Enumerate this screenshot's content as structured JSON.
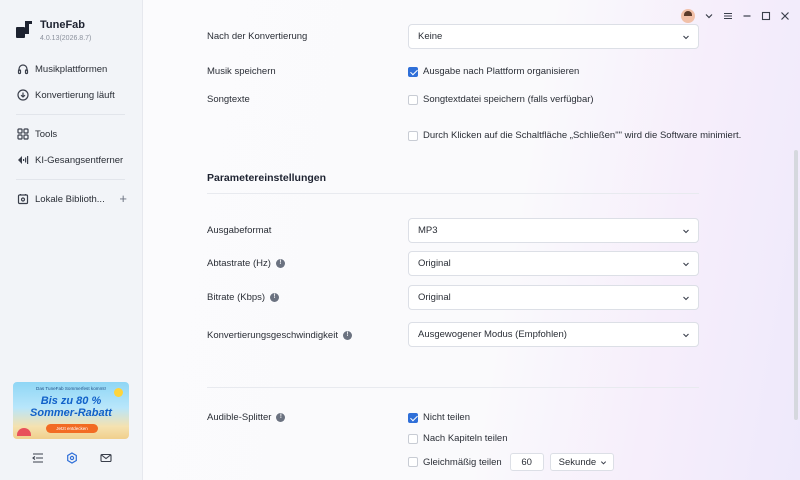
{
  "brand": {
    "name": "TuneFab",
    "version": "4.0.13(2026.8.7)"
  },
  "sidebar": {
    "items": [
      {
        "label": "Musikplattformen",
        "icon": "headphones-icon"
      },
      {
        "label": "Konvertierung läuft",
        "icon": "download-circle-icon"
      },
      {
        "label": "Tools",
        "icon": "grid-icon"
      },
      {
        "label": "KI-Gesangsentferner",
        "icon": "voice-remove-icon"
      },
      {
        "label": "Lokale Biblioth...",
        "icon": "library-icon"
      }
    ],
    "add_symbol": "+"
  },
  "promo": {
    "top_text": "Das TuneFab Sommerfest kommt!",
    "line1": "Bis zu 80 %",
    "line2": "Sommer-Rabatt",
    "button": "Jetzt entdecken"
  },
  "settings": {
    "after_conversion": {
      "label": "Nach der Konvertierung",
      "value": "Keine"
    },
    "save_music": {
      "label": "Musik speichern",
      "option": "Ausgabe nach Plattform organisieren",
      "checked": true
    },
    "lyrics": {
      "label": "Songtexte",
      "option": "Songtextdatei speichern (falls verfügbar)",
      "checked": false
    },
    "minimize": {
      "option": "Durch Klicken auf die Schaltfläche „Schließen\"\" wird die Software minimiert.",
      "checked": false
    }
  },
  "params": {
    "title": "Parametereinstellungen",
    "format": {
      "label": "Ausgabeformat",
      "value": "MP3"
    },
    "samplerate": {
      "label": "Abtastrate (Hz)",
      "value": "Original"
    },
    "bitrate": {
      "label": "Bitrate (Kbps)",
      "value": "Original"
    },
    "speed": {
      "label": "Konvertierungsgeschwindigkeit",
      "value": "Ausgewogener Modus (Empfohlen)"
    }
  },
  "audible": {
    "label": "Audible-Splitter",
    "options": [
      {
        "label": "Nicht teilen",
        "checked": true
      },
      {
        "label": "Nach Kapiteln teilen",
        "checked": false
      },
      {
        "label": "Gleichmäßig teilen",
        "checked": false
      }
    ],
    "split_value": "60",
    "split_unit": "Sekunde"
  },
  "colors": {
    "accent": "#2f6fd8",
    "sidebar_bg": "#f2f4f8"
  }
}
